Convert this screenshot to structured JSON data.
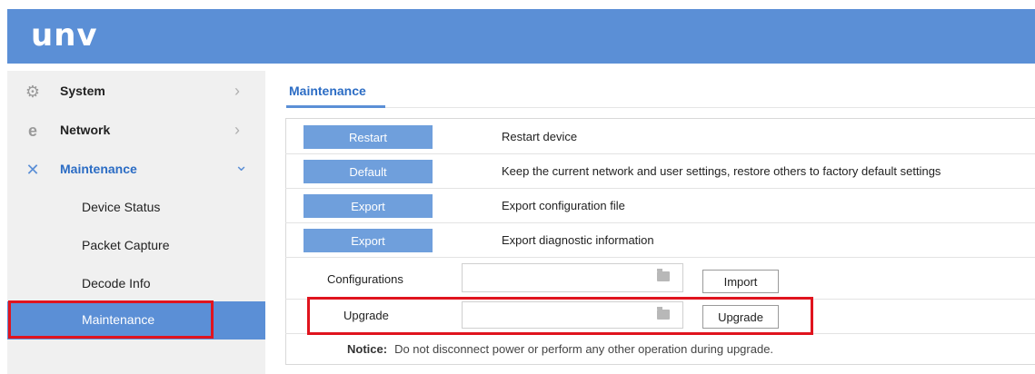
{
  "header": {
    "logo": "unv"
  },
  "sidebar": {
    "items": [
      {
        "label": "System",
        "icon": "gear-icon",
        "chevron": "›"
      },
      {
        "label": "Network",
        "icon": "network-e-icon",
        "chevron": "›"
      },
      {
        "label": "Maintenance",
        "icon": "tools-icon",
        "chevron": "⌄"
      }
    ],
    "subitems": [
      {
        "label": "Device Status"
      },
      {
        "label": "Packet Capture"
      },
      {
        "label": "Decode Info"
      },
      {
        "label": "Maintenance",
        "active": true
      }
    ]
  },
  "main": {
    "tab": "Maintenance",
    "actions": [
      {
        "button": "Restart",
        "description": "Restart device"
      },
      {
        "button": "Default",
        "description": "Keep the current network and user settings, restore others to factory default settings"
      },
      {
        "button": "Export",
        "description": "Export configuration file"
      },
      {
        "button": "Export",
        "description": "Export diagnostic information"
      }
    ],
    "configurations": {
      "label": "Configurations",
      "value": "",
      "button": "Import"
    },
    "upgrade": {
      "label": "Upgrade",
      "value": "",
      "button": "Upgrade"
    },
    "notice": {
      "title": "Notice:",
      "text": "Do not disconnect power or perform any other operation during upgrade."
    }
  },
  "colors": {
    "header": "#5b8fd6",
    "accent_button": "#6f9fdc",
    "highlight": "#e0141e",
    "sidebar_bg": "#f0f0f0"
  }
}
